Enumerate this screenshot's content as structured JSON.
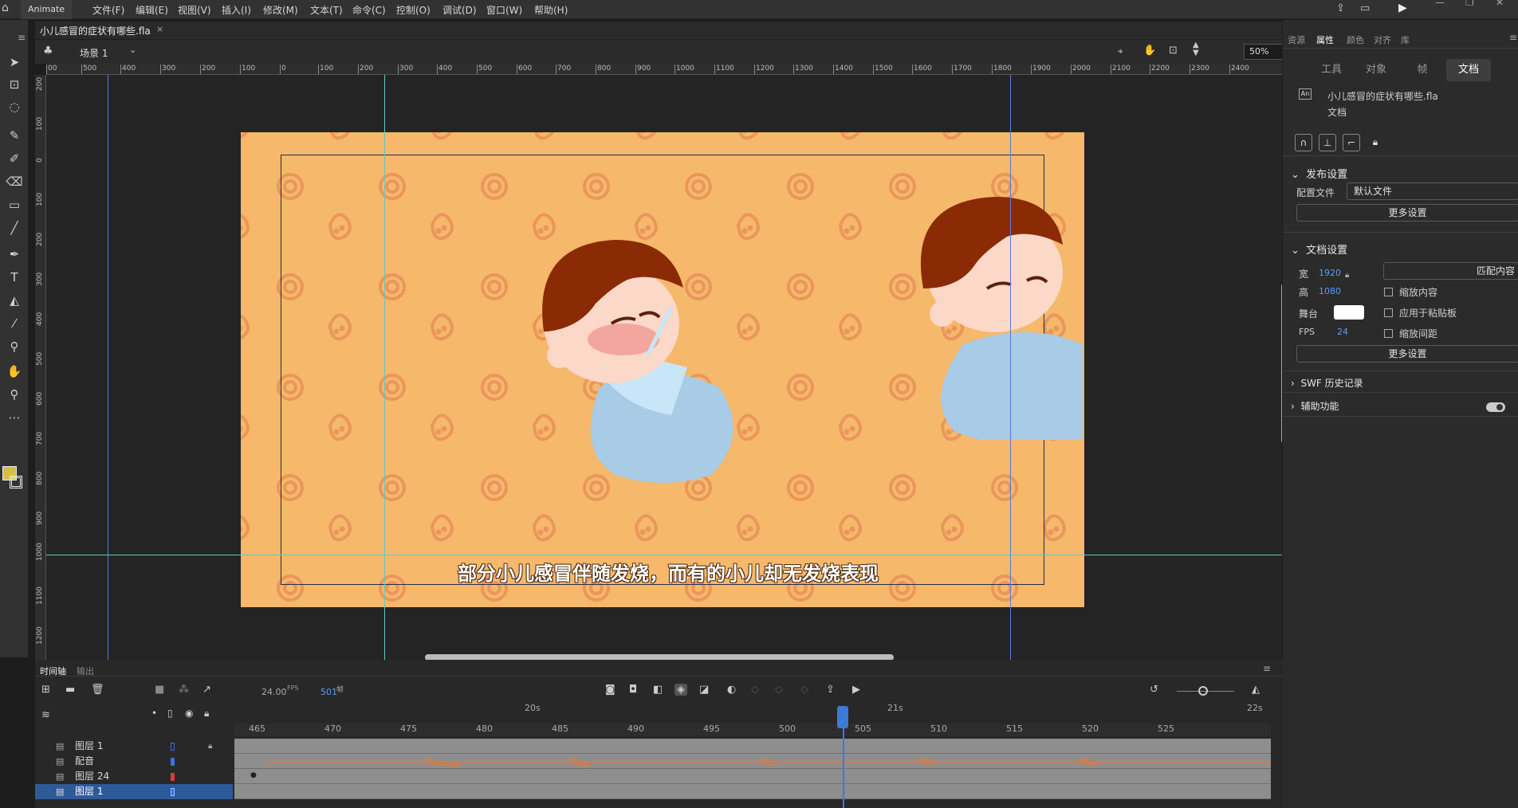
{
  "menubar": {
    "app_name": "Animate",
    "items": [
      "文件(F)",
      "编辑(E)",
      "视图(V)",
      "插入(I)",
      "修改(M)",
      "文本(T)",
      "命令(C)",
      "控制(O)",
      "调试(D)",
      "窗口(W)",
      "帮助(H)"
    ]
  },
  "document": {
    "tab_title": "小儿感冒的症状有哪些.fla",
    "close": "×"
  },
  "scene": {
    "name": "场景 1",
    "zoom": "50%"
  },
  "ruler": {
    "h_labels": [
      "00",
      "500",
      "400",
      "300",
      "200",
      "100",
      "0",
      "100",
      "200",
      "300",
      "400",
      "500",
      "600",
      "700",
      "800",
      "900",
      "1000",
      "1100",
      "1200",
      "1300",
      "1400",
      "1500",
      "1600",
      "1700",
      "1800",
      "1900",
      "2000",
      "2100",
      "2200",
      "2300",
      "2400"
    ],
    "v_labels": [
      "200",
      "100",
      "0",
      "100",
      "200",
      "300",
      "400",
      "500",
      "600",
      "700",
      "800",
      "900",
      "1000",
      "1100",
      "1200"
    ]
  },
  "stage": {
    "subtitle": "部分小儿感冒伴随发烧，而有的小儿却无发烧表现",
    "bg_color": "#f6b86a"
  },
  "right_panel": {
    "top_tabs": [
      "资源",
      "属性",
      "颜色",
      "对齐",
      "库"
    ],
    "active_top_tab": "属性",
    "sub_tabs": [
      "工具",
      "对象",
      "帧",
      "文档"
    ],
    "active_sub_tab": "文档",
    "doc_name": "小儿感冒的症状有哪些.fla",
    "doc_type": "文档",
    "doc_icon": "An",
    "publish": {
      "header": "发布设置",
      "profile_label": "配置文件",
      "profile_value": "默认文件",
      "more": "更多设置"
    },
    "docsettings": {
      "header": "文档设置",
      "width_label": "宽",
      "width": "1920",
      "height_label": "高",
      "height": "1080",
      "match": "匹配内容",
      "scale_content": "缩放内容",
      "apply_paste": "应用于粘贴板",
      "stage_label": "舞台",
      "stage_color": "#ffffff",
      "fps_label": "FPS",
      "fps": "24",
      "scale_spacing": "缩放间距",
      "more": "更多设置"
    },
    "swf_history": "SWF 历史记录",
    "accessibility": "辅助功能"
  },
  "timeline": {
    "tabs": [
      "时间轴",
      "输出"
    ],
    "fps": "24.00",
    "fps_unit": "FPS",
    "frame": "501",
    "frame_unit": "帧",
    "sec_labels": [
      "20s",
      "21s",
      "22s"
    ],
    "frame_numbers": [
      "465",
      "470",
      "475",
      "480",
      "485",
      "490",
      "495",
      "500",
      "505",
      "510",
      "515",
      "520",
      "525"
    ],
    "layers": [
      {
        "name": "图层 1",
        "color": "#3a6fe0"
      },
      {
        "name": "配音",
        "color": "#3a6fe0"
      },
      {
        "name": "图层 24",
        "color": "#e03a3a"
      },
      {
        "name": "图层 1",
        "color": "#3a6fe0"
      }
    ]
  }
}
